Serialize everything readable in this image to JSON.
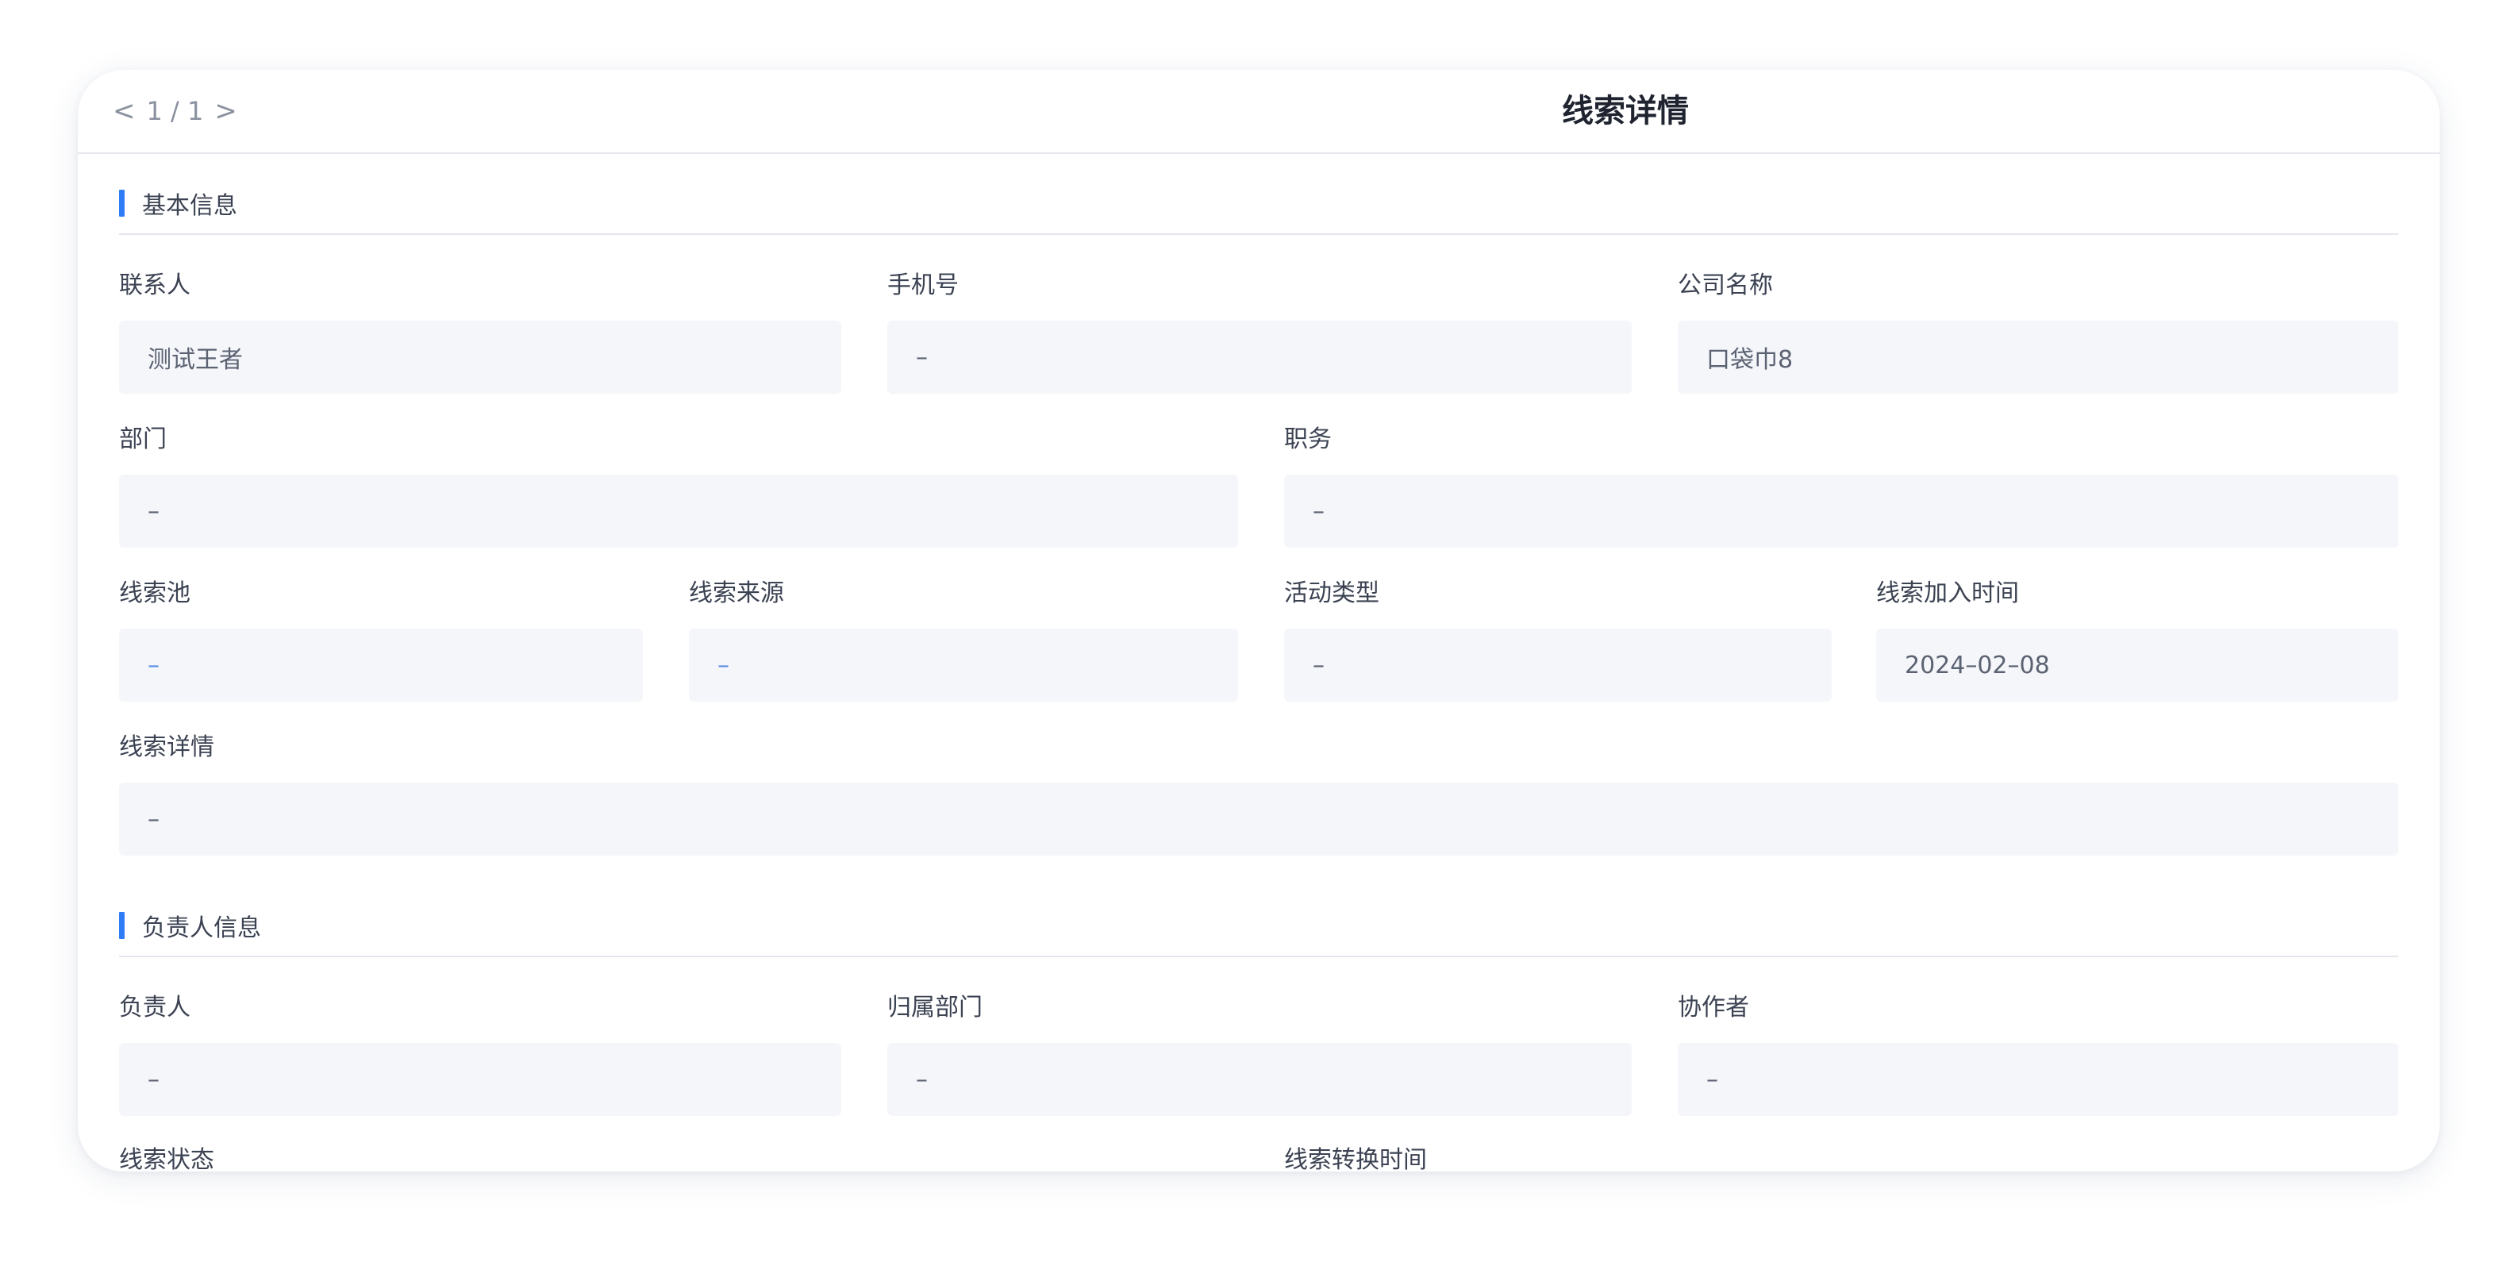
{
  "header": {
    "pager_prev": "<",
    "pager_text": "1 / 1",
    "pager_next": ">",
    "title": "线索详情"
  },
  "basic": {
    "section_title": "基本信息",
    "contact_label": "联系人",
    "contact_value": "测试王者",
    "phone_label": "手机号",
    "phone_value": "–",
    "company_label": "公司名称",
    "company_value": "口袋巾8",
    "dept_label": "部门",
    "dept_value": "–",
    "position_label": "职务",
    "position_value": "–",
    "pool_label": "线索池",
    "pool_value": "–",
    "source_label": "线索来源",
    "source_value": "–",
    "activity_label": "活动类型",
    "activity_value": "–",
    "joined_label": "线索加入时间",
    "joined_value": "2024–02–08",
    "detail_label": "线索详情",
    "detail_value": "–"
  },
  "owner": {
    "section_title": "负责人信息",
    "owner_label": "负责人",
    "owner_value": "–",
    "dept_label": "归属部门",
    "dept_value": "–",
    "collab_label": "协作者",
    "collab_value": "–",
    "status_label": "线索状态",
    "convert_time_label": "线索转换时间"
  },
  "colors": {
    "accent": "#2f7df6",
    "field_bg": "#f5f6fa",
    "link": "#5a8fe6"
  }
}
